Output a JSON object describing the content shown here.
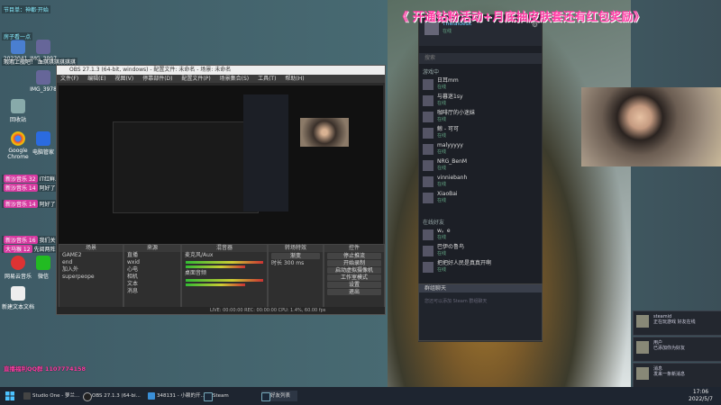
{
  "banner": "《 开通钻粉活动+月底抽皮肤套还有红包奖励》",
  "desktop_icons": [
    "2022041...",
    "回收站",
    "IMG_3997",
    "IMG_3978",
    "Google Chrome",
    "电脑管家",
    "网易云音乐",
    "微信",
    "新建文本文档"
  ],
  "chat": [
    {
      "text": "节目单：神都·开始"
    },
    {
      "text": "房子看一点"
    },
    {
      "text": "瑕瑕上舰吧！ 血琪琪琪琪琪琪"
    },
    {
      "badge": "新沙音乐 32",
      "text": "IT红鲜人 先阅两阵"
    },
    {
      "badge": "新沙音乐 14",
      "text": "阿好了，味好大"
    },
    {
      "badge": "新沙音乐 14",
      "text": "阿好了 味好大"
    },
    {
      "badge": "新沙音乐 16",
      "text": "我们关注"
    },
    {
      "badge": "大马猴 12",
      "text": "先阅两阵"
    }
  ],
  "qq_promo": "直播福利QQ群 1107774158",
  "obs": {
    "title": "OBS 27.1.3 (64-bit, windows) - 配置文件: 未命名 - 场景: 未命名",
    "menu": [
      "文件(F)",
      "编辑(E)",
      "视图(V)",
      "停靠部件(D)",
      "配置文件(P)",
      "场景集合(S)",
      "工具(T)",
      "帮助(H)"
    ],
    "panels": {
      "scenes": {
        "title": "场景",
        "items": [
          "GAME2",
          "end",
          "加入外",
          "superpeope"
        ]
      },
      "sources": {
        "title": "来源",
        "items": [
          "直播",
          "wxid",
          "心电",
          "相机",
          "文本",
          "消息"
        ]
      },
      "mixer": {
        "title": "混音器",
        "items": [
          "麦克风/Aux",
          "桌面音频"
        ]
      },
      "transitions": {
        "title": "转场特效",
        "type": "渐变",
        "duration_label": "时长",
        "duration": "300 ms"
      },
      "controls": {
        "title": "控件",
        "buttons": [
          "停止推流",
          "开始录制",
          "启动虚拟摄像机",
          "工作室模式",
          "设置",
          "退出"
        ]
      }
    },
    "status": "LIVE: 00:00:00   REC: 00:00:00   CPU: 1.4%, 60.00 fps"
  },
  "steam": {
    "user": "Theialdesk",
    "status": "在线",
    "search_placeholder": "搜索",
    "group_game": "游戏中",
    "group_online": "在线好友",
    "friends": [
      {
        "name": "日耳mm",
        "status": "在线"
      },
      {
        "name": "与暮迷1sy",
        "status": "在线"
      },
      {
        "name": "咖啡厅的小迷妹",
        "status": "在线"
      },
      {
        "name": "鲸 - 可可",
        "status": "在线"
      },
      {
        "name": "malyyyyy",
        "status": "在线"
      },
      {
        "name": "NRG_BenM",
        "status": "在线"
      },
      {
        "name": "vinniebanh",
        "status": "在线"
      },
      {
        "name": "XiaoBai",
        "status": "在线"
      }
    ],
    "online_friends": [
      {
        "name": "w。e",
        "status": "在线"
      },
      {
        "name": "巴伊の鲁鸟",
        "status": "在线"
      },
      {
        "name": "把把好人民是真真开啊",
        "status": "在线"
      }
    ],
    "chat_header": "群组聊天",
    "chat_body": "您还可以添加 Steam 群组聊天"
  },
  "notifications": [
    {
      "name": "steamid",
      "text": "正在玩游戏 好友在线"
    },
    {
      "name": "用户",
      "text": "已添加你为好友"
    },
    {
      "name": "消息",
      "text": "发来一条新消息"
    }
  ],
  "taskbar": {
    "items": [
      "Studio One - 萝兰...",
      "OBS 27.1.3 (64-bi...",
      "348131 - 小赖的开...",
      "Steam",
      "好友列表"
    ],
    "time": "17:06",
    "date": "2022/5/7"
  },
  "colors": {
    "accent_pink": "#ff3fa6",
    "steam_bg": "#1c1f26",
    "obs_bg": "#2b2b2b"
  }
}
